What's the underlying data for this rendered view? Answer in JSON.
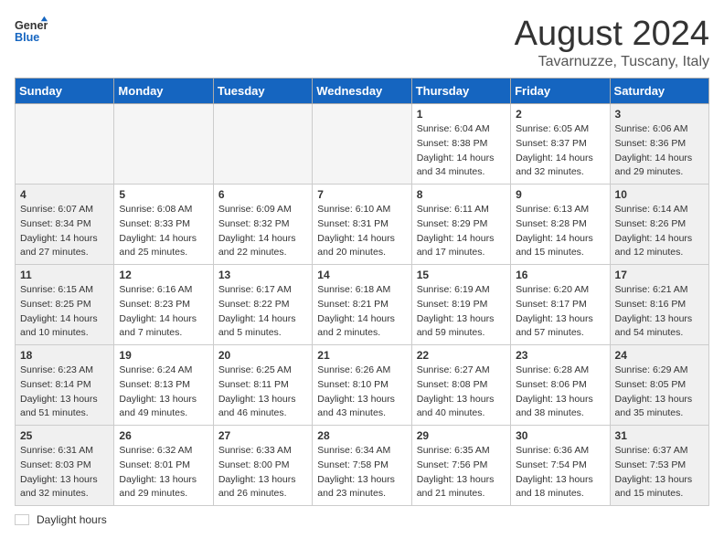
{
  "header": {
    "logo_general": "General",
    "logo_blue": "Blue",
    "month_year": "August 2024",
    "location": "Tavarnuzze, Tuscany, Italy"
  },
  "weekdays": [
    "Sunday",
    "Monday",
    "Tuesday",
    "Wednesday",
    "Thursday",
    "Friday",
    "Saturday"
  ],
  "weeks": [
    [
      {
        "day": "",
        "empty": true
      },
      {
        "day": "",
        "empty": true
      },
      {
        "day": "",
        "empty": true
      },
      {
        "day": "",
        "empty": true
      },
      {
        "day": "1",
        "sunrise": "6:04 AM",
        "sunset": "8:38 PM",
        "daylight": "14 hours and 34 minutes."
      },
      {
        "day": "2",
        "sunrise": "6:05 AM",
        "sunset": "8:37 PM",
        "daylight": "14 hours and 32 minutes."
      },
      {
        "day": "3",
        "sunrise": "6:06 AM",
        "sunset": "8:36 PM",
        "daylight": "14 hours and 29 minutes."
      }
    ],
    [
      {
        "day": "4",
        "sunrise": "6:07 AM",
        "sunset": "8:34 PM",
        "daylight": "14 hours and 27 minutes."
      },
      {
        "day": "5",
        "sunrise": "6:08 AM",
        "sunset": "8:33 PM",
        "daylight": "14 hours and 25 minutes."
      },
      {
        "day": "6",
        "sunrise": "6:09 AM",
        "sunset": "8:32 PM",
        "daylight": "14 hours and 22 minutes."
      },
      {
        "day": "7",
        "sunrise": "6:10 AM",
        "sunset": "8:31 PM",
        "daylight": "14 hours and 20 minutes."
      },
      {
        "day": "8",
        "sunrise": "6:11 AM",
        "sunset": "8:29 PM",
        "daylight": "14 hours and 17 minutes."
      },
      {
        "day": "9",
        "sunrise": "6:13 AM",
        "sunset": "8:28 PM",
        "daylight": "14 hours and 15 minutes."
      },
      {
        "day": "10",
        "sunrise": "6:14 AM",
        "sunset": "8:26 PM",
        "daylight": "14 hours and 12 minutes."
      }
    ],
    [
      {
        "day": "11",
        "sunrise": "6:15 AM",
        "sunset": "8:25 PM",
        "daylight": "14 hours and 10 minutes."
      },
      {
        "day": "12",
        "sunrise": "6:16 AM",
        "sunset": "8:23 PM",
        "daylight": "14 hours and 7 minutes."
      },
      {
        "day": "13",
        "sunrise": "6:17 AM",
        "sunset": "8:22 PM",
        "daylight": "14 hours and 5 minutes."
      },
      {
        "day": "14",
        "sunrise": "6:18 AM",
        "sunset": "8:21 PM",
        "daylight": "14 hours and 2 minutes."
      },
      {
        "day": "15",
        "sunrise": "6:19 AM",
        "sunset": "8:19 PM",
        "daylight": "13 hours and 59 minutes."
      },
      {
        "day": "16",
        "sunrise": "6:20 AM",
        "sunset": "8:17 PM",
        "daylight": "13 hours and 57 minutes."
      },
      {
        "day": "17",
        "sunrise": "6:21 AM",
        "sunset": "8:16 PM",
        "daylight": "13 hours and 54 minutes."
      }
    ],
    [
      {
        "day": "18",
        "sunrise": "6:23 AM",
        "sunset": "8:14 PM",
        "daylight": "13 hours and 51 minutes."
      },
      {
        "day": "19",
        "sunrise": "6:24 AM",
        "sunset": "8:13 PM",
        "daylight": "13 hours and 49 minutes."
      },
      {
        "day": "20",
        "sunrise": "6:25 AM",
        "sunset": "8:11 PM",
        "daylight": "13 hours and 46 minutes."
      },
      {
        "day": "21",
        "sunrise": "6:26 AM",
        "sunset": "8:10 PM",
        "daylight": "13 hours and 43 minutes."
      },
      {
        "day": "22",
        "sunrise": "6:27 AM",
        "sunset": "8:08 PM",
        "daylight": "13 hours and 40 minutes."
      },
      {
        "day": "23",
        "sunrise": "6:28 AM",
        "sunset": "8:06 PM",
        "daylight": "13 hours and 38 minutes."
      },
      {
        "day": "24",
        "sunrise": "6:29 AM",
        "sunset": "8:05 PM",
        "daylight": "13 hours and 35 minutes."
      }
    ],
    [
      {
        "day": "25",
        "sunrise": "6:31 AM",
        "sunset": "8:03 PM",
        "daylight": "13 hours and 32 minutes."
      },
      {
        "day": "26",
        "sunrise": "6:32 AM",
        "sunset": "8:01 PM",
        "daylight": "13 hours and 29 minutes."
      },
      {
        "day": "27",
        "sunrise": "6:33 AM",
        "sunset": "8:00 PM",
        "daylight": "13 hours and 26 minutes."
      },
      {
        "day": "28",
        "sunrise": "6:34 AM",
        "sunset": "7:58 PM",
        "daylight": "13 hours and 23 minutes."
      },
      {
        "day": "29",
        "sunrise": "6:35 AM",
        "sunset": "7:56 PM",
        "daylight": "13 hours and 21 minutes."
      },
      {
        "day": "30",
        "sunrise": "6:36 AM",
        "sunset": "7:54 PM",
        "daylight": "13 hours and 18 minutes."
      },
      {
        "day": "31",
        "sunrise": "6:37 AM",
        "sunset": "7:53 PM",
        "daylight": "13 hours and 15 minutes."
      }
    ]
  ],
  "legend": {
    "daylight_label": "Daylight hours"
  }
}
